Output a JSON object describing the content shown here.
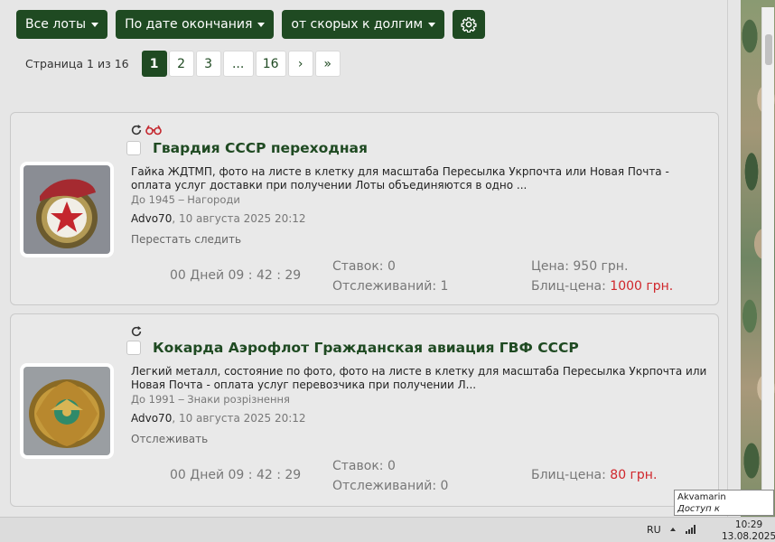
{
  "toolbar": {
    "filter_label": "Все лоты",
    "sort_label": "По дате окончания",
    "order_label": "от скорых к долгим"
  },
  "pagination": {
    "info": "Страница 1 из 16",
    "pages": [
      "1",
      "2",
      "3",
      "...",
      "16"
    ],
    "next": "›",
    "last": "»"
  },
  "lots": [
    {
      "title": "Гвардия СССР переходная",
      "description": "Гайка ЖДТМП, фото на листе в клетку для масштаба Пересылка Укрпочта или Новая Почта - оплата услуг доставки при получении Лоты объединяются в одно ...",
      "period": "До 1945",
      "category": "Нагороди",
      "seller": "Advo70",
      "date": ", 10 августа 2025 20:12",
      "watch_action": "Перестать следить",
      "timer": "00 Дней 09 : 42 : 29",
      "bids": "Ставок: 0",
      "watchers": "Отслеживаний: 1",
      "price_label": "Цена: 950 грн.",
      "blitz_label": "Блиц-цена: ",
      "blitz_value": "1000 грн."
    },
    {
      "title": "Кокарда Аэрофлот Гражданская авиация ГВФ СССР",
      "description": "Легкий металл, состояние по фото, фото на листе в клетку для масштаба Пересылка Укрпочта или Новая Почта - оплата услуг перевозчика при получении Л...",
      "period": "До 1991",
      "category": "Знаки розрізнення",
      "seller": "Advo70",
      "date": ", 10 августа 2025 20:12",
      "watch_action": "Отслеживать",
      "timer": "00 Дней 09 : 42 : 29",
      "bids": "Ставок: 0",
      "watchers": "Отслеживаний: 0",
      "blitz_label": "Блиц-цена: ",
      "blitz_value": "80 грн."
    }
  ],
  "taskbar": {
    "lang": "RU",
    "time": "10:29",
    "date": "13.08.2025"
  },
  "tooltip": {
    "title": "Akvamarin",
    "subtitle": "Доступ к Интернету"
  },
  "colors": {
    "accent": "#1f4a22",
    "blitz": "#d0262b"
  }
}
